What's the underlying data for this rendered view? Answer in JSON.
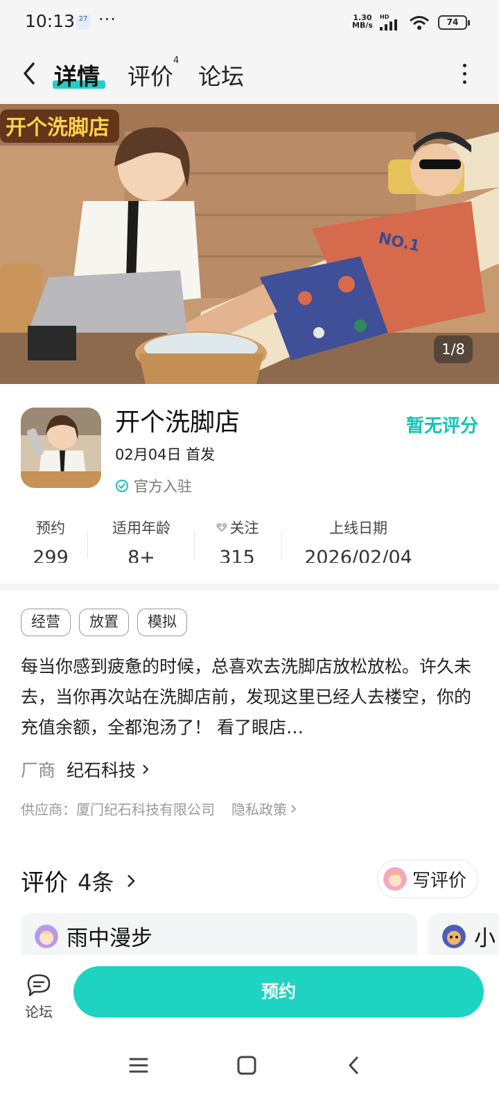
{
  "status_bar": {
    "time": "10:13",
    "calendar_day": "27",
    "more": "···",
    "net_speed_value": "1.30",
    "net_speed_unit": "MB/s",
    "hd": "HD",
    "battery": "74"
  },
  "nav": {
    "tabs": [
      {
        "label": "详情",
        "active": true
      },
      {
        "label": "评价",
        "badge": "4"
      },
      {
        "label": "论坛"
      }
    ]
  },
  "banner": {
    "logo_text": "开个洗脚店",
    "shirt_text": "NO.1",
    "counter": "1/8"
  },
  "app": {
    "name": "开个洗脚店",
    "release": "02月04日 首发",
    "official": "官方入驻",
    "rating": "暂无评分"
  },
  "stats": [
    {
      "label": "预约",
      "value": "299"
    },
    {
      "label": "适用年龄",
      "value": "8+"
    },
    {
      "label": "关注",
      "value": "315"
    },
    {
      "label": "上线日期",
      "value": "2026/02/04"
    }
  ],
  "tags": [
    "经营",
    "放置",
    "模拟"
  ],
  "description": "每当你感到疲惫的时候，总喜欢去洗脚店放松放松。许久未去，当你再次站在洗脚店前，发现这里已经人去楼空，你的充值余额，全都泡汤了！ 看了眼店…",
  "vendor": {
    "label": "厂商",
    "name": "纪石科技"
  },
  "supplier": {
    "text": "供应商：厦门纪石科技有限公司",
    "privacy": "隐私政策"
  },
  "reviews": {
    "title": "评价",
    "count": "4条",
    "write_button": "写评价",
    "cards": [
      {
        "user": "雨中漫步"
      },
      {
        "user": "小"
      }
    ]
  },
  "bottom": {
    "forum_label": "论坛",
    "reserve_label": "预约"
  },
  "colors": {
    "accent": "#1fd3c3",
    "rating": "#13c3b7"
  }
}
